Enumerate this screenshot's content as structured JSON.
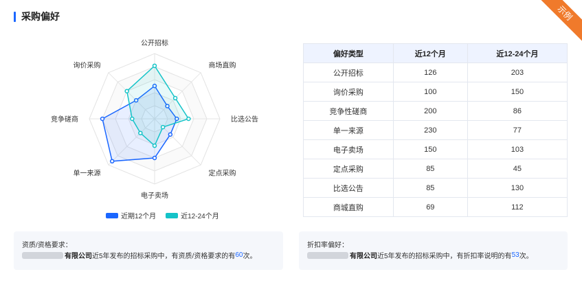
{
  "title": "采购偏好",
  "ribbon": "示例",
  "colors": {
    "series1": "#1a66ff",
    "series2": "#14c3c8"
  },
  "chart_data": {
    "type": "radar",
    "axes": [
      "公开招标",
      "商场直购",
      "比选公告",
      "定点采购",
      "电子卖场",
      "单一来源",
      "竞争磋商",
      "询价采购"
    ],
    "max": 250,
    "series": [
      {
        "name": "近期12个月",
        "values": [
          126,
          69,
          85,
          85,
          150,
          230,
          200,
          100
        ]
      },
      {
        "name": "近12-24个月",
        "values": [
          203,
          112,
          130,
          45,
          103,
          77,
          86,
          150
        ]
      }
    ]
  },
  "table": {
    "headers": [
      "偏好类型",
      "近12个月",
      "近12-24个月"
    ],
    "rows": [
      [
        "公开招标",
        "126",
        "203"
      ],
      [
        "询价采购",
        "100",
        "150"
      ],
      [
        "竞争性磋商",
        "200",
        "86"
      ],
      [
        "单一来源",
        "230",
        "77"
      ],
      [
        "电子卖场",
        "150",
        "103"
      ],
      [
        "定点采购",
        "85",
        "45"
      ],
      [
        "比选公告",
        "85",
        "130"
      ],
      [
        "商城直购",
        "69",
        "112"
      ]
    ]
  },
  "cards": [
    {
      "heading": "资质/资格要求：",
      "company": "有限公司",
      "text_before": "近5年发布的招标采购中，有资质/资格要求的有",
      "count": "60",
      "text_after": "次。"
    },
    {
      "heading": "折扣率偏好：",
      "company": "有限公司",
      "text_before": "近5年发布的招标采购中，有折扣率说明的有",
      "count": "53",
      "text_after": "次。"
    }
  ]
}
